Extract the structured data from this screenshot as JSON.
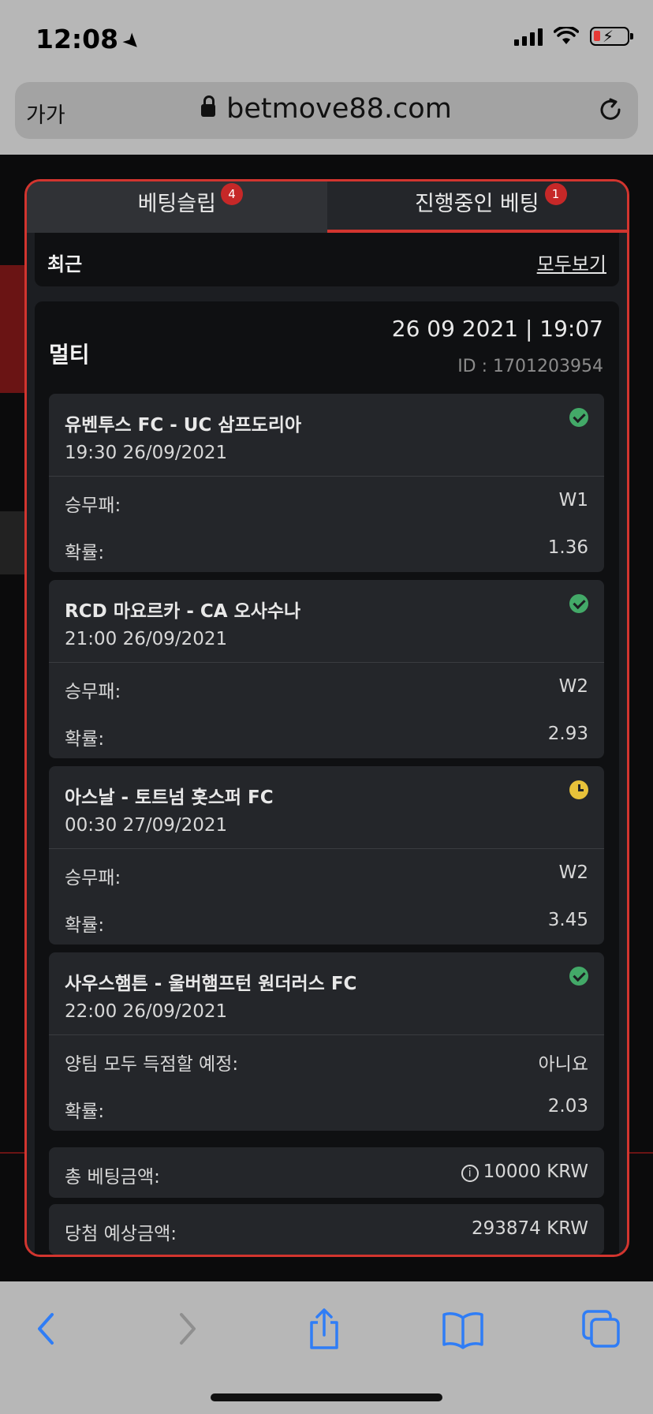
{
  "status_bar": {
    "time": "12:08",
    "battery_level_fraction": 0.15
  },
  "browser": {
    "aa_label": "가가",
    "url": "betmove88.com"
  },
  "tabs": [
    {
      "label": "베팅슬립",
      "badge": "4"
    },
    {
      "label": "진행중인 베팅",
      "badge": "1"
    }
  ],
  "recent": {
    "label": "최근",
    "see_all": "모두보기"
  },
  "bet": {
    "type": "멀티",
    "date": "26 09 2021 | 19:07",
    "id": "ID :  1701203954",
    "matches": [
      {
        "name": "유벤투스 FC - UC 삼프도리아",
        "time": "19:30   26/09/2021",
        "row1_label": "승무패:",
        "row1_value": "W1",
        "row2_label": "확률:",
        "row2_value": "1.36",
        "status": "check-circle-icon"
      },
      {
        "name": "RCD 마요르카 - CA 오사수나",
        "time": "21:00   26/09/2021",
        "row1_label": "승무패:",
        "row1_value": "W2",
        "row2_label": "확률:",
        "row2_value": "2.93",
        "status": "check-circle-icon"
      },
      {
        "name": "아스날 - 토트넘 홋스퍼 FC",
        "time": "00:30   27/09/2021",
        "row1_label": "승무패:",
        "row1_value": "W2",
        "row2_label": "확률:",
        "row2_value": "3.45",
        "status": "clock-icon"
      },
      {
        "name": "사우스햄튼 - 울버햄프턴 원더러스 FC",
        "time": "22:00   26/09/2021",
        "row1_label": "양팀 모두 득점할 예정:",
        "row1_value": "아니요",
        "row2_label": "확률:",
        "row2_value": "2.03",
        "status": "check-circle-icon"
      }
    ],
    "total_stake_label": "총 베팅금액:",
    "total_stake_value": "10000 KRW",
    "potential_win_label": "당첨 예상금액:",
    "potential_win_value": "293874 KRW"
  },
  "colors": {
    "accent": "#d2352f",
    "success": "#43a968",
    "pending": "#e8c23a",
    "toolbar_icon": "#2f7df6"
  }
}
